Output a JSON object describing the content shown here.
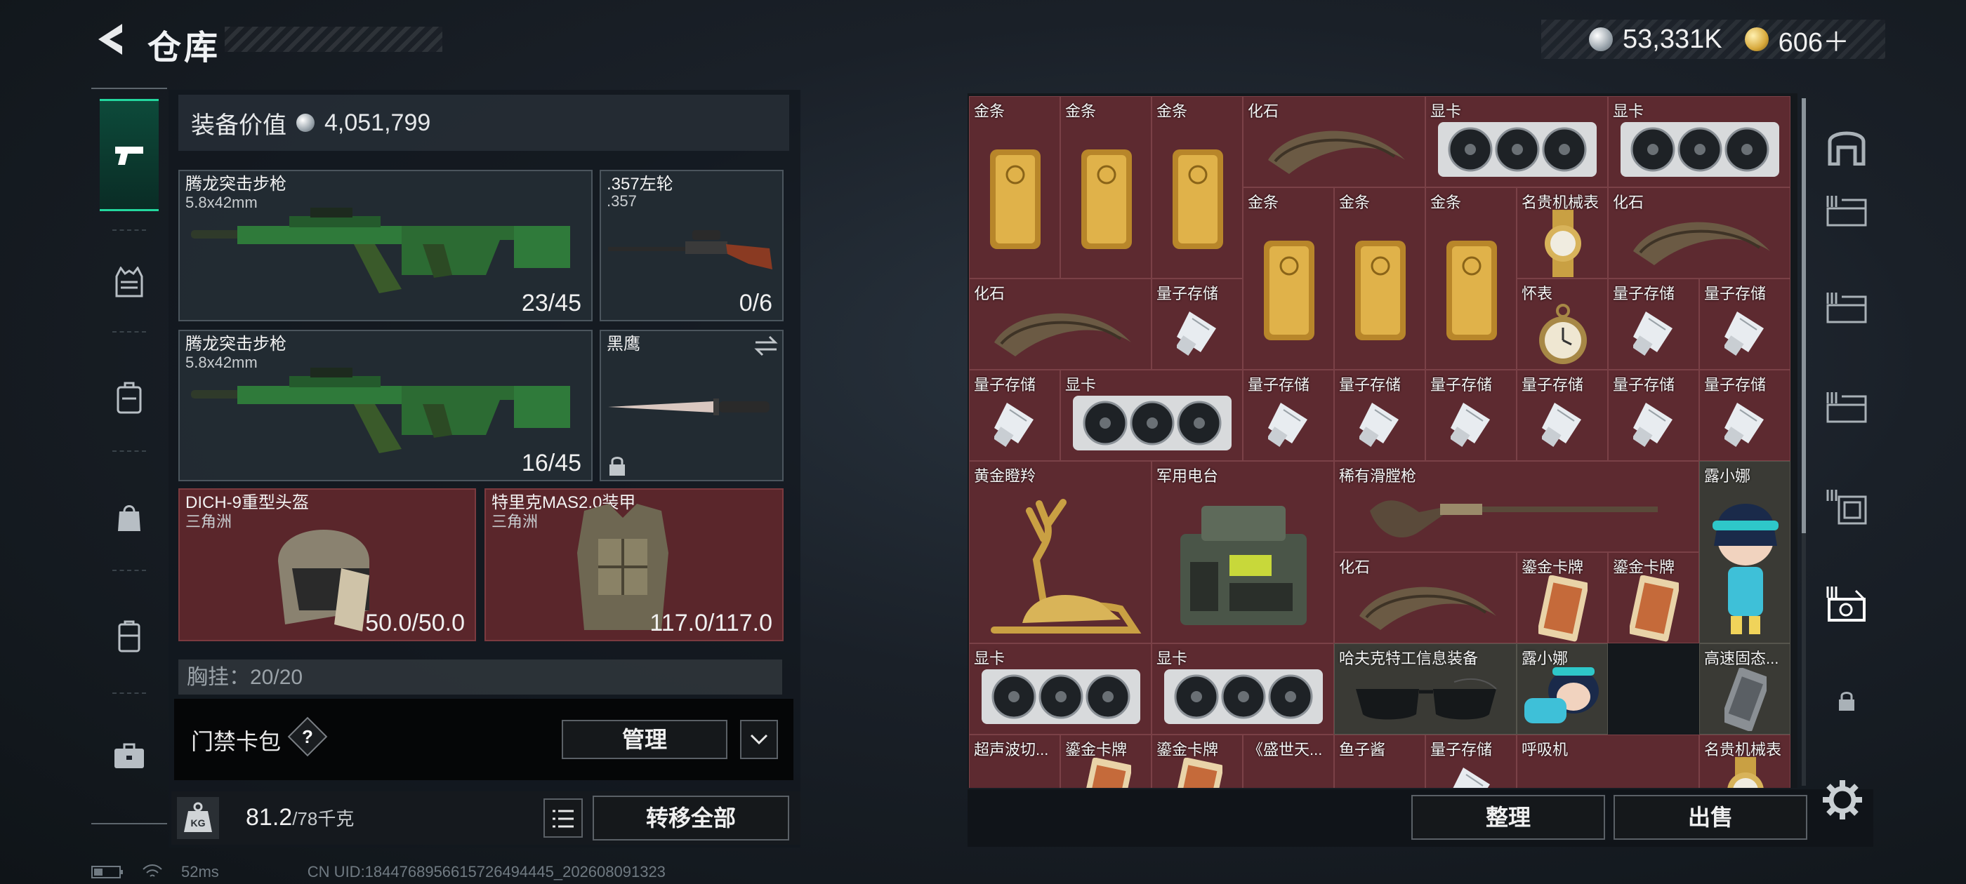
{
  "header": {
    "title": "仓库"
  },
  "currency": {
    "silver": "53,331K",
    "gold": "606＋"
  },
  "loadout": {
    "value_label": "装备价值",
    "value": "4,051,799",
    "slots": [
      {
        "name": "腾龙突击步枪",
        "sub": "5.8x42mm",
        "count": "23/45"
      },
      {
        "name": ".357左轮",
        "sub": ".357",
        "count": "0/6"
      },
      {
        "name": "腾龙突击步枪",
        "sub": "5.8x42mm",
        "count": "16/45"
      },
      {
        "name": "黑鹰",
        "sub": "",
        "count": ""
      },
      {
        "name": "DICH-9重型头盔",
        "sub": "三角洲",
        "count": "50.0/50.0"
      },
      {
        "name": "特里克MAS2.0装甲",
        "sub": "三角洲",
        "count": "117.0/117.0"
      }
    ],
    "chest_row": "胸挂：20/20"
  },
  "keycard": {
    "label": "门禁卡包",
    "help": "?",
    "manage": "管理"
  },
  "weight": {
    "value": "81.2",
    "max": "/78千克",
    "transfer_all": "转移全部"
  },
  "status": {
    "ping": "52ms",
    "uid": "CN UID:1844768956615726494445_202608091323"
  },
  "stash": {
    "items": [
      {
        "name": "金条"
      },
      {
        "name": "金条"
      },
      {
        "name": "金条"
      },
      {
        "name": "化石"
      },
      {
        "name": "显卡"
      },
      {
        "name": "显卡"
      },
      {
        "name": "金条"
      },
      {
        "name": "金条"
      },
      {
        "name": "金条"
      },
      {
        "name": "名贵机械表"
      },
      {
        "name": "化石"
      },
      {
        "name": "化石"
      },
      {
        "name": "量子存储"
      },
      {
        "name": "怀表"
      },
      {
        "name": "量子存储"
      },
      {
        "name": "量子存储"
      },
      {
        "name": "量子存储"
      },
      {
        "name": "显卡"
      },
      {
        "name": "量子存储"
      },
      {
        "name": "量子存储"
      },
      {
        "name": "量子存储"
      },
      {
        "name": "量子存储"
      },
      {
        "name": "量子存储"
      },
      {
        "name": "量子存储"
      },
      {
        "name": "黄金瞪羚"
      },
      {
        "name": "军用电台"
      },
      {
        "name": "稀有滑膛枪"
      },
      {
        "name": "露小娜"
      },
      {
        "name": "化石"
      },
      {
        "name": "鎏金卡牌"
      },
      {
        "name": "鎏金卡牌"
      },
      {
        "name": "显卡"
      },
      {
        "name": "显卡"
      },
      {
        "name": "哈夫克特工信息装备"
      },
      {
        "name": "露小娜"
      },
      {
        "name": "高速固态..."
      },
      {
        "name": "超声波切..."
      },
      {
        "name": "鎏金卡牌"
      },
      {
        "name": "鎏金卡牌"
      },
      {
        "name": "《盛世天..."
      },
      {
        "name": "鱼子酱"
      },
      {
        "name": "量子存储"
      },
      {
        "name": "呼吸机"
      },
      {
        "name": "名贵机械表"
      }
    ],
    "sort": "整理",
    "sell": "出售"
  },
  "colors": {
    "accent": "#23d79e",
    "item_bg": "#5d2a30",
    "gold": "#d7a93c"
  }
}
